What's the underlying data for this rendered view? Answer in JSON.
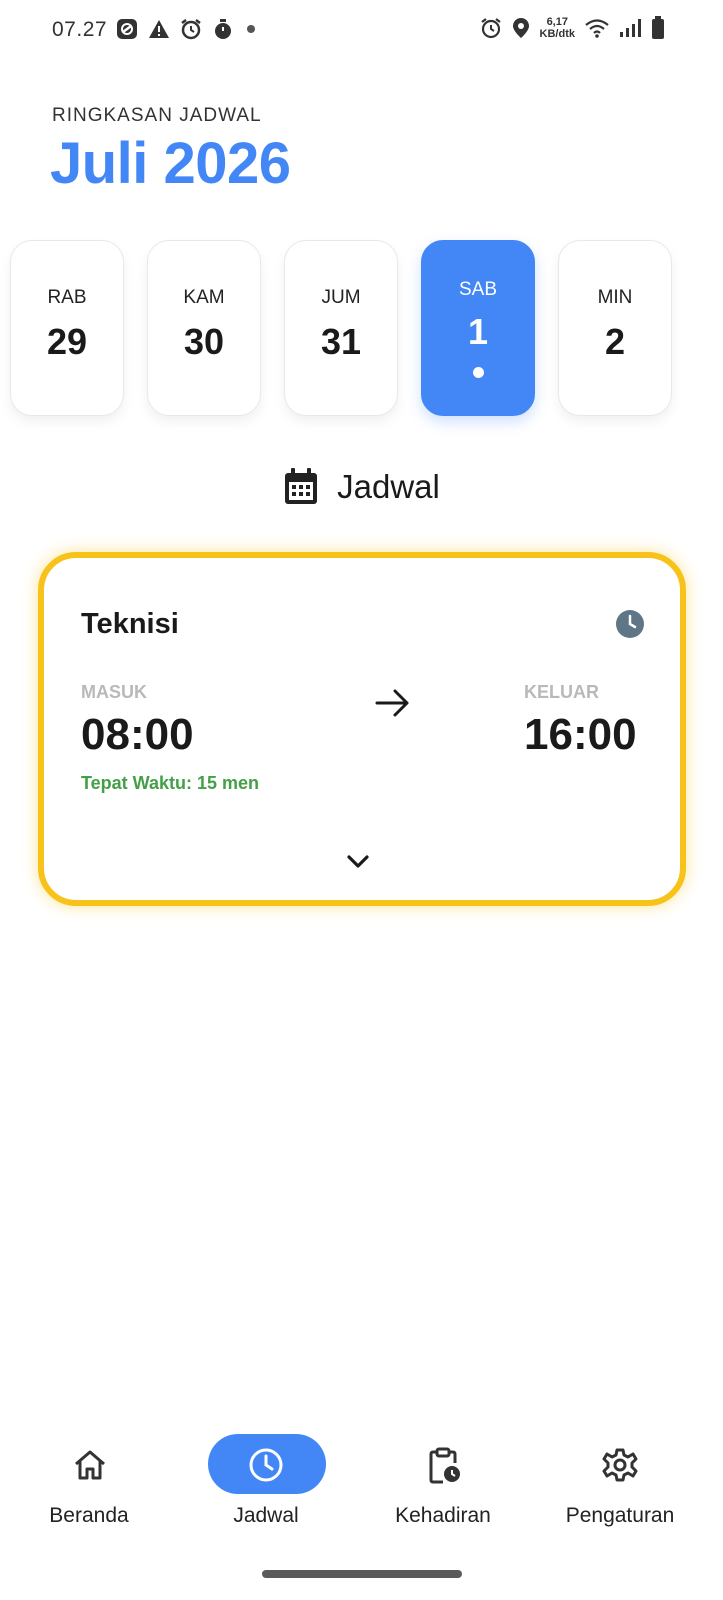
{
  "status_bar": {
    "time": "07.27",
    "speed_value": "6,17",
    "speed_unit": "KB/dtk",
    "left_icons": [
      "app-notification-icon",
      "warning-icon",
      "alarm-icon",
      "timer-icon",
      "dot-icon"
    ],
    "right_icons": [
      "alarm-icon",
      "location-icon",
      "wifi-icon",
      "signal-icon",
      "battery-icon"
    ]
  },
  "header": {
    "subtitle": "RINGKASAN JADWAL",
    "month": "Juli 2026"
  },
  "days": [
    {
      "name": "RAB",
      "number": "29",
      "selected": false
    },
    {
      "name": "KAM",
      "number": "30",
      "selected": false
    },
    {
      "name": "JUM",
      "number": "31",
      "selected": false
    },
    {
      "name": "SAB",
      "number": "1",
      "selected": true
    },
    {
      "name": "MIN",
      "number": "2",
      "selected": false
    }
  ],
  "section": {
    "icon": "calendar-icon",
    "title": "Jadwal"
  },
  "schedule": {
    "role": "Teknisi",
    "in_label": "MASUK",
    "in_time": "08:00",
    "status": "Tepat Waktu: 15 men",
    "out_label": "KELUAR",
    "out_time": "16:00"
  },
  "nav": [
    {
      "label": "Beranda",
      "icon": "home-icon",
      "active": false
    },
    {
      "label": "Jadwal",
      "icon": "clock-icon",
      "active": true
    },
    {
      "label": "Kehadiran",
      "icon": "clipboard-clock-icon",
      "active": false
    },
    {
      "label": "Pengaturan",
      "icon": "gear-icon",
      "active": false
    }
  ],
  "colors": {
    "accent": "#4287f5",
    "highlight_border": "#f7c31a",
    "on_time": "#43a047",
    "muted_label": "#b9b9b9"
  }
}
